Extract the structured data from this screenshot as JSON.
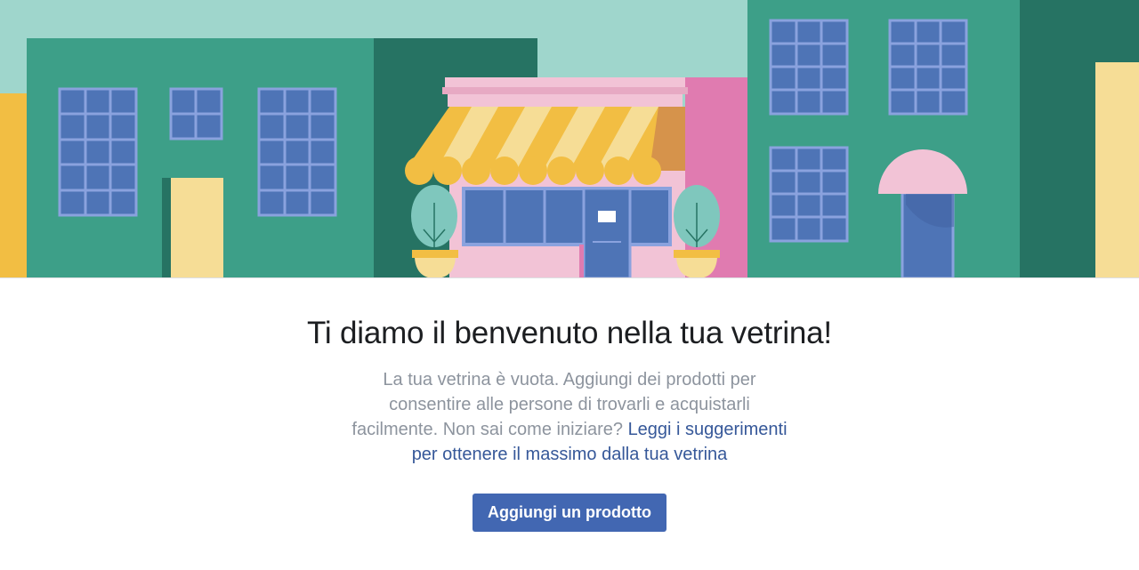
{
  "banner": {
    "colors": {
      "sky": "#9fd6cc",
      "green": "#3d9f88",
      "dark_green": "#267363",
      "window": "#4e74b6",
      "window_frame": "#8aa2de",
      "yellow": "#f2be43",
      "pale_yellow": "#f6dd96",
      "pink": "#f2c3d6",
      "magenta": "#e07bb0",
      "orange": "#d6934b"
    }
  },
  "welcome": {
    "title": "Ti diamo il benvenuto nella tua vetrina!",
    "description": "La tua vetrina è vuota. Aggiungi dei prodotti per consentire alle persone di trovarli e acquistarli facilmente. Non sai come iniziare? ",
    "link_text": "Leggi i suggerimenti per ottenere il massimo dalla tua vetrina",
    "button_label": "Aggiungi un prodotto"
  }
}
